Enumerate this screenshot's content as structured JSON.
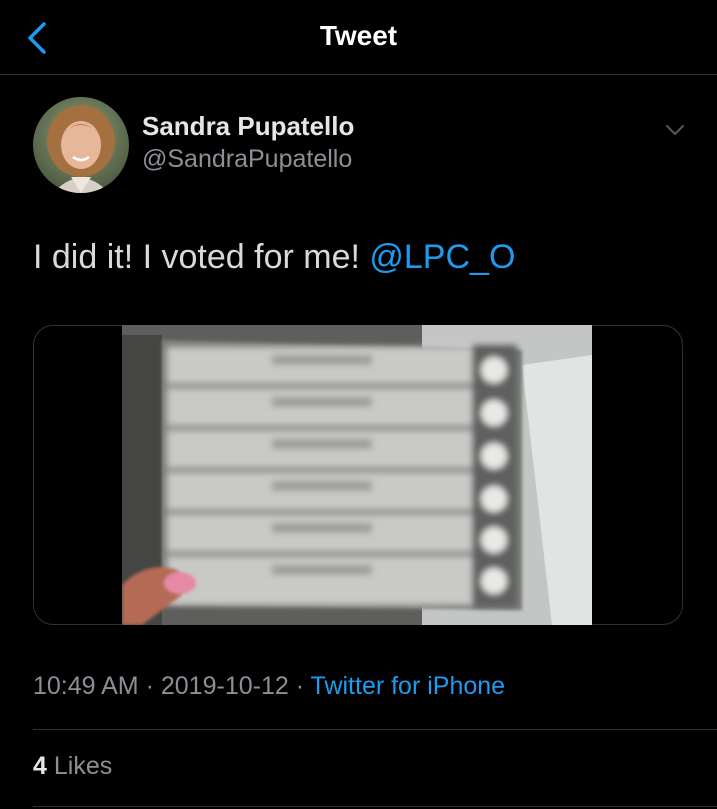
{
  "nav": {
    "title": "Tweet"
  },
  "author": {
    "display_name": "Sandra Pupatello",
    "handle": "@SandraPupatello"
  },
  "tweet": {
    "text": "I did it! I voted for me!",
    "mention": "@LPC_O"
  },
  "meta": {
    "time": "10:49 AM",
    "separator": "·",
    "date": "2019-10-12",
    "source": "Twitter for iPhone"
  },
  "stats": {
    "likes_count": "4",
    "likes_label": "Likes"
  },
  "icons": {
    "back": "chevron-left-icon",
    "menu": "chevron-down-icon"
  },
  "colors": {
    "background": "#000000",
    "accent": "#1d9bf0",
    "secondary_text": "#8b9096",
    "divider": "#2f3336"
  }
}
